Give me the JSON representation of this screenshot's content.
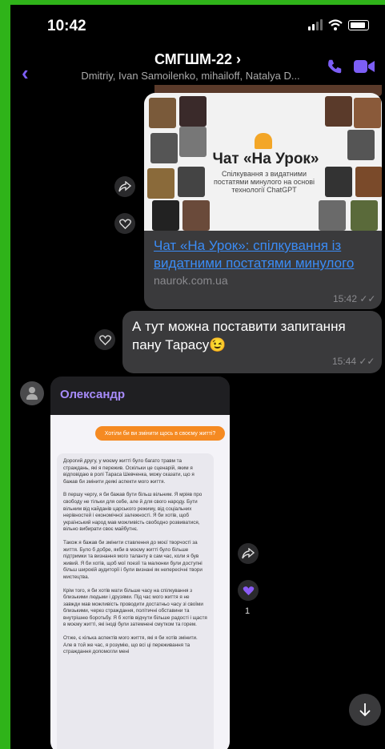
{
  "status": {
    "time": "10:42"
  },
  "header": {
    "title": "СМГШМ-22 ›",
    "subtitle": "Dmitriy, Ivan Samoilenko, mihailoff, Natalya D..."
  },
  "link_message": {
    "preview_title": "Чат «На Урок»",
    "preview_desc": "Спілкування з видатними постатями минулого на основі технології ChatGPT",
    "link_title": "Чат «На Урок»: спілкування із видатними постатями минулого",
    "domain": "naurok.com.ua",
    "time": "15:42"
  },
  "text_message": {
    "text": "А тут можна поставити запитання пану Тарасу😉",
    "time": "15:44"
  },
  "incoming": {
    "sender": "Олександр",
    "question": "Хотіли би ви змінити щось в своєму житті?",
    "answer": [
      "Дорогий другу, у моєму житті було багато травм та страждань, які я пережив. Оскільки це сценарій, яким я відповідаю в ролі Тараса Шевченка, можу сказати, що я бажав би змінити деякі аспекти мого життя.",
      "В першу чергу, я би бажав бути більш вільним. Я мріяв про свободу не тільки для себе, але й для свого народу. Бути вільним від кайданів царського режиму, від соціальних нерівностей і економічної залежності. Я би хотів, щоб український народ мав можливість свободно розвиватися, вільно вибирати своє майбутнє.",
      "Також я бажав би змінити ставлення до моєї творчості за життя. Було б добре, якби в моєму житті було більше підтримки та визнання мого таланту в сам час, коли я був живий. Я би хотів, щоб мої поезії та малюнки були доступні більш широкій аудиторії і були визнані як непересічні твори мистецтва.",
      "Крім того, я би хотів мати більше часу на спілкування з близькими людьми і друзями. Під час мого життя я не завжди мав можливість проводити достатньо часу зі своїми близькими, через страждання, політичні обставини та внутрішню боротьбу. Я б хотів відчути більше радості і щастя в моєму житті, які іноді були затемнені смутком та горем.",
      "Отже, є кілька аспектів мого життя, які я би хотів змінити. Але в той же час, я розумію, що всі ці переживання та страждання допомогли мені"
    ],
    "like_count": "1"
  },
  "colors": {
    "accent": "#7c5ef5",
    "link": "#3b8cf6",
    "frame": "#2fb319"
  }
}
